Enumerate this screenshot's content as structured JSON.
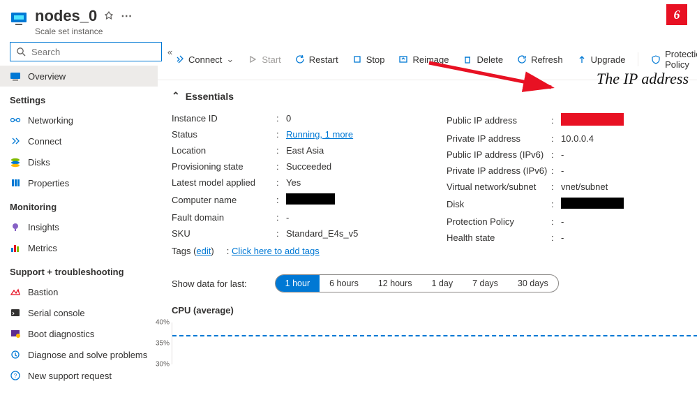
{
  "header": {
    "title": "nodes_0",
    "subtitle": "Scale set instance"
  },
  "sidebar": {
    "search_placeholder": "Search",
    "items": [
      {
        "label": "Overview",
        "active": true
      },
      {
        "label": "Networking"
      },
      {
        "label": "Connect"
      },
      {
        "label": "Disks"
      },
      {
        "label": "Properties"
      },
      {
        "label": "Insights"
      },
      {
        "label": "Metrics"
      },
      {
        "label": "Bastion"
      },
      {
        "label": "Serial console"
      },
      {
        "label": "Boot diagnostics"
      },
      {
        "label": "Diagnose and solve problems"
      },
      {
        "label": "New support request"
      }
    ],
    "section_settings": "Settings",
    "section_monitoring": "Monitoring",
    "section_support": "Support + troubleshooting"
  },
  "toolbar": {
    "connect": "Connect",
    "start": "Start",
    "restart": "Restart",
    "stop": "Stop",
    "reimage": "Reimage",
    "delete": "Delete",
    "refresh": "Refresh",
    "upgrade": "Upgrade",
    "protection": "Protection Policy"
  },
  "essentials": {
    "header": "Essentials",
    "left": {
      "instance_id_label": "Instance ID",
      "instance_id": "0",
      "status_label": "Status",
      "status": "Running, 1 more",
      "location_label": "Location",
      "location": "East Asia",
      "prov_label": "Provisioning state",
      "prov": "Succeeded",
      "model_label": "Latest model applied",
      "model": "Yes",
      "comp_label": "Computer name",
      "fault_label": "Fault domain",
      "fault": "-",
      "sku_label": "SKU",
      "sku": "Standard_E4s_v5"
    },
    "right": {
      "pubip_label": "Public IP address",
      "privip_label": "Private IP address",
      "privip": "10.0.0.4",
      "pubip6_label": "Public IP address (IPv6)",
      "pubip6": "-",
      "privip6_label": "Private IP address (IPv6)",
      "privip6": "-",
      "vnet_label": "Virtual network/subnet",
      "vnet": "vnet/subnet",
      "disk_label": "Disk",
      "protpol_label": "Protection Policy",
      "protpol": "-",
      "health_label": "Health state",
      "health": "-"
    },
    "tags_label": "Tags",
    "tags_edit": "edit",
    "tags_link": "Click here to add tags"
  },
  "ranges": {
    "label": "Show data for last:",
    "options": [
      "1 hour",
      "6 hours",
      "12 hours",
      "1 day",
      "7 days",
      "30 days"
    ],
    "active": 0
  },
  "chart_data": {
    "type": "line",
    "title": "CPU (average)",
    "ylabel": "%",
    "ylim": [
      30,
      40
    ],
    "y_ticks": [
      30,
      35,
      40
    ],
    "series": [
      {
        "name": "CPU (average)",
        "style": "dashed",
        "color": "#0078d4",
        "values": [
          37,
          37,
          37,
          37,
          37,
          37,
          37,
          37,
          37,
          37,
          37,
          37,
          37,
          37,
          37,
          37,
          37,
          37,
          37,
          37
        ]
      }
    ]
  },
  "annotation": {
    "badge": "6",
    "text": "The IP address"
  }
}
